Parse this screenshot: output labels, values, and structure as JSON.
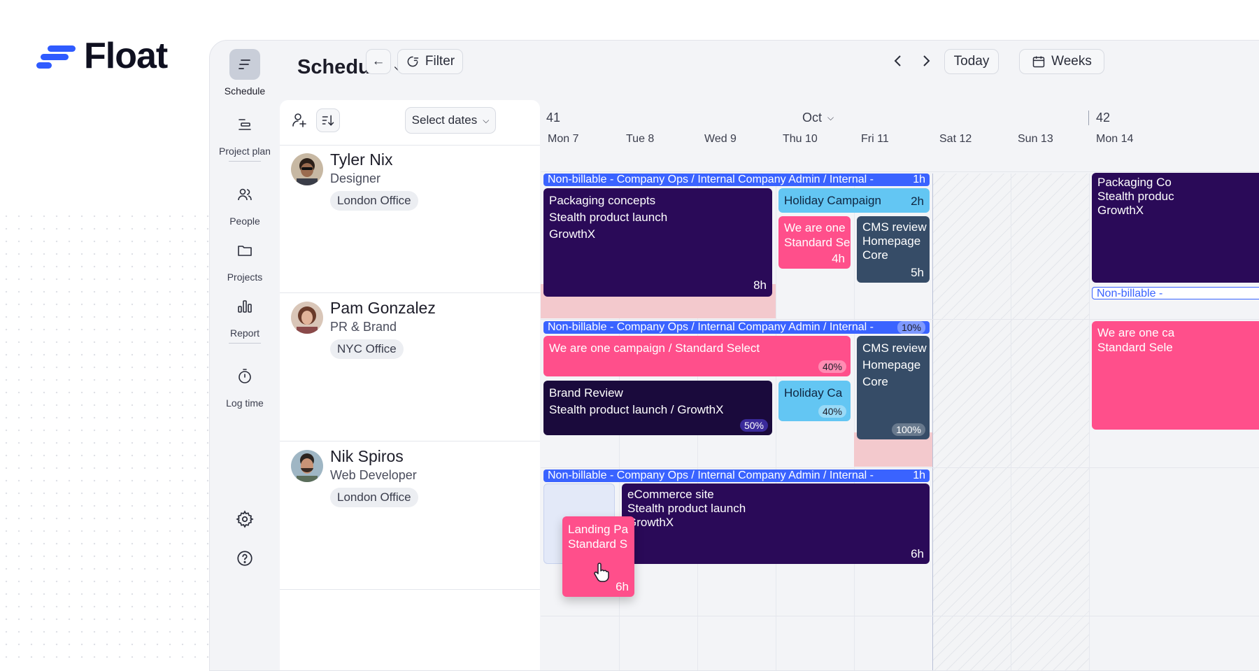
{
  "brand": {
    "name": "Float",
    "color": "#2f5bff"
  },
  "nav": {
    "items": [
      {
        "label": "Schedule",
        "icon": "schedule-icon",
        "active": true
      },
      {
        "label": "Project plan",
        "icon": "project-plan-icon"
      },
      {
        "label": "People",
        "icon": "people-icon"
      },
      {
        "label": "Projects",
        "icon": "folder-icon"
      },
      {
        "label": "Report",
        "icon": "report-icon"
      },
      {
        "label": "Log time",
        "icon": "stopwatch-icon"
      }
    ],
    "bottom": [
      {
        "icon": "gear-icon"
      },
      {
        "icon": "help-icon"
      }
    ]
  },
  "toolbar": {
    "title": "Schedule",
    "filter_label": "Filter",
    "today_label": "Today",
    "view_label": "Weeks",
    "select_dates_label": "Select dates"
  },
  "timeline": {
    "month": "Oct",
    "week_a": "41",
    "week_b": "42",
    "days": [
      "Mon 7",
      "Tue 8",
      "Wed 9",
      "Thu 10",
      "Fri 11",
      "Sat 12",
      "Sun 13",
      "Mon 14"
    ]
  },
  "people": [
    {
      "name": "Tyler Nix",
      "role": "Designer",
      "office": "London Office"
    },
    {
      "name": "Pam Gonzalez",
      "role": "PR & Brand",
      "office": "NYC Office"
    },
    {
      "name": "Nik Spiros",
      "role": "Web Developer",
      "office": "London Office"
    }
  ],
  "tasks": {
    "nonbillable_label": "Non-billable - Company Ops / Internal Company Admin / Internal -",
    "nonbillable_short": "Non-billable -",
    "r1_nb_hrs": "1h",
    "r2_nb_pct": "10%",
    "r3_nb_hrs": "1h",
    "pack_l1": "Packaging concepts",
    "pack_l2": "Stealth product launch",
    "pack_l3": "GrowthX",
    "pack_hrs": "8h",
    "holiday_label": "Holiday Campaign",
    "holiday_hrs": "2h",
    "weare_l1": "We are one",
    "weare_l2": "Standard Se",
    "weare_hrs": "4h",
    "cms_l1": "CMS review",
    "cms_l2": "Homepage",
    "cms_l3": "Core",
    "cms_hrs": "5h",
    "pack14_l1": "Packaging Co",
    "pack14_l2": "Stealth produc",
    "pack14_l3": "GrowthX",
    "weare2_label": "We are one campaign / Standard Select",
    "weare2_pct": "40%",
    "brand_l1": "Brand Review",
    "brand_l2": "Stealth product launch / GrowthX",
    "brand_pct": "50%",
    "holiday2_label": "Holiday Ca",
    "holiday2_pct": "40%",
    "cms2_pct": "100%",
    "weare14_l1": "We are one ca",
    "weare14_l2": "Standard Sele",
    "ecom_l1": "eCommerce site",
    "ecom_l2": "Stealth product launch",
    "ecom_l3": "GrowthX",
    "ecom_hrs": "6h",
    "landing_l1": "Landing Pa",
    "landing_l2": "Standard S",
    "landing_hrs": "6h"
  }
}
